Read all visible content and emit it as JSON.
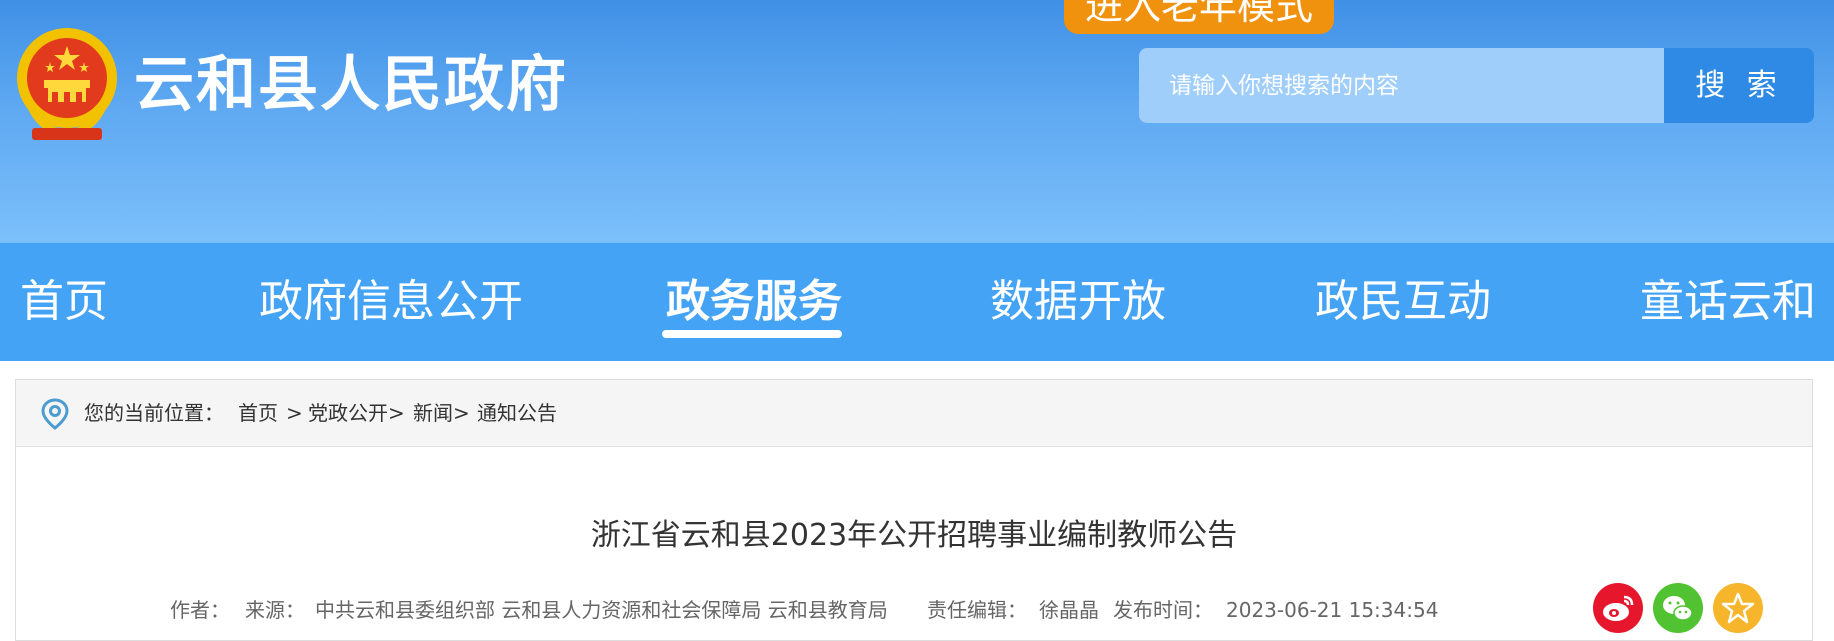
{
  "header": {
    "site_title": "云和县人民政府",
    "elder_mode_label": "进入老年模式",
    "search": {
      "placeholder": "请输入你想搜索的内容",
      "button_label": "搜 索"
    }
  },
  "nav": {
    "items": [
      {
        "label": "首页"
      },
      {
        "label": "政府信息公开"
      },
      {
        "label": "政务服务",
        "active": true
      },
      {
        "label": "数据开放"
      },
      {
        "label": "政民互动"
      },
      {
        "label": "童话云和"
      }
    ]
  },
  "breadcrumb": {
    "prefix": "您的当前位置：",
    "items": [
      "首页",
      ">",
      "党政公开>",
      "新闻>",
      "通知公告"
    ]
  },
  "article": {
    "title": "浙江省云和县2023年公开招聘事业编制教师公告",
    "meta": {
      "author_label": "作者：",
      "author": "",
      "source_label": "来源：",
      "source": "中共云和县委组织部 云和县人力资源和社会保障局 云和县教育局",
      "editor_label": "责任编辑：",
      "editor": "徐晶晶",
      "publish_label": "发布时间：",
      "publish_time": "2023-06-21 15:34:54"
    }
  },
  "share": [
    {
      "icon": "weibo-icon",
      "color": "#e6162d"
    },
    {
      "icon": "wechat-icon",
      "color": "#51c332"
    },
    {
      "icon": "favorite-star-icon",
      "color": "#f6b52a"
    }
  ],
  "colors": {
    "header_top": "#3f90e6",
    "nav_bg": "#44a3f5",
    "elder_button": "#f0920d",
    "search_button": "#2f8ae6"
  }
}
